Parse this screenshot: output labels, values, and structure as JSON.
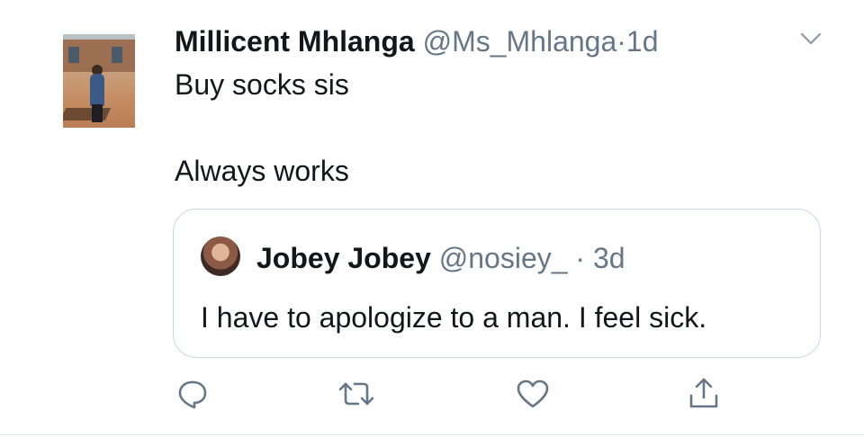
{
  "tweet": {
    "author_name": "Millicent Mhlanga",
    "author_handle": "@Ms_Mhlanga",
    "separator": "·",
    "time": "1d",
    "lines": [
      "Buy socks sis",
      "Always works"
    ]
  },
  "quoted": {
    "author_name": "Jobey Jobey",
    "author_handle": "@nosiey_",
    "separator": "·",
    "time": "3d",
    "text": "I have to apologize to a man. I feel sick."
  },
  "actions": {
    "icons": [
      "reply-icon",
      "retweet-icon",
      "like-icon",
      "share-icon"
    ]
  },
  "colors": {
    "text": "#14171a",
    "secondary": "#657786",
    "border": "#ccd6dd",
    "icon": "#657786"
  }
}
